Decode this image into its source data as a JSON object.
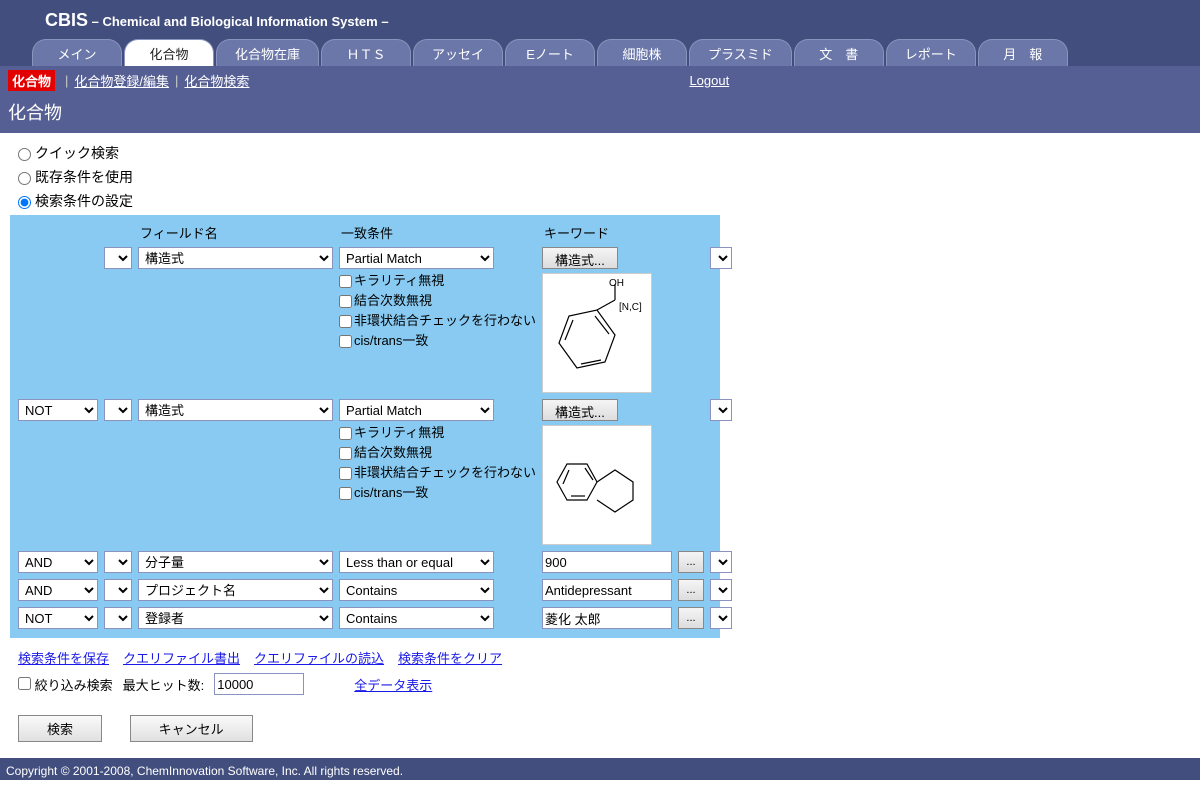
{
  "app": {
    "short": "CBIS",
    "full": "– Chemical and Biological Information System –"
  },
  "tabs": [
    "メイン",
    "化合物",
    "化合物在庫",
    "ＨＴＳ",
    "アッセイ",
    "Eノート",
    "細胞株",
    "プラスミド",
    "文　書",
    "レポート",
    "月　報"
  ],
  "active_tab_index": 1,
  "subnav": {
    "current": "化合物",
    "items": [
      "化合物登録/編集",
      "化合物検索"
    ],
    "logout": "Logout"
  },
  "page_title": "化合物",
  "search_mode": {
    "options": [
      "クイック検索",
      "既存条件を使用",
      "検索条件の設定"
    ],
    "selected_index": 2
  },
  "table_headers": {
    "field": "フィールド名",
    "match": "一致条件",
    "keyword": "キーワード"
  },
  "rows": [
    {
      "logic": "",
      "field": "構造式",
      "match": "Partial Match",
      "checkboxes": [
        "キラリティ無視",
        "結合次数無視",
        "非環状結合チェックを行わない",
        "cis/trans一致"
      ],
      "structure_button": "構造式...",
      "structure": "benzene-NOH-NC"
    },
    {
      "logic": "NOT",
      "field": "構造式",
      "match": "Partial Match",
      "checkboxes": [
        "キラリティ無視",
        "結合次数無視",
        "非環状結合チェックを行わない",
        "cis/trans一致"
      ],
      "structure_button": "構造式...",
      "structure": "naphthalene-partial"
    },
    {
      "logic": "AND",
      "field": "分子量",
      "match": "Less than or equal",
      "keyword": "900"
    },
    {
      "logic": "AND",
      "field": "プロジェクト名",
      "match": "Contains",
      "keyword": "Antidepressant"
    },
    {
      "logic": "NOT",
      "field": "登録者",
      "match": "Contains",
      "keyword": "菱化 太郎"
    }
  ],
  "links": [
    "検索条件を保存",
    "クエリファイル書出",
    "クエリファイルの読込",
    "検索条件をクリア"
  ],
  "narrow": {
    "checkbox": "絞り込み検索",
    "maxhit_label": "最大ヒット数:",
    "maxhit_value": "10000",
    "all_data": "全データ表示"
  },
  "buttons": {
    "search": "検索",
    "cancel": "キャンセル"
  },
  "footer": "Copyright © 2001-2008, ChemInnovation Software, Inc. All rights reserved."
}
